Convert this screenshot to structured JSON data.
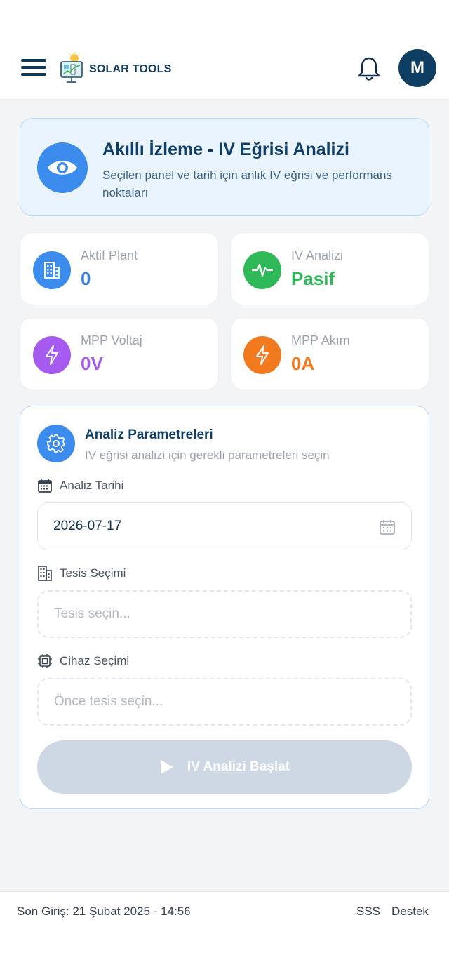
{
  "header": {
    "brand": "SOLAR TOOLS",
    "avatar_initial": "M"
  },
  "hero": {
    "title": "Akıllı İzleme - IV Eğrisi Analizi",
    "subtitle": "Seçilen panel ve tarih için anlık IV eğrisi ve performans noktaları"
  },
  "stats": [
    {
      "label": "Aktif Plant",
      "value": "0",
      "icon": "building-icon",
      "color": "#3b8ced"
    },
    {
      "label": "IV Analizi",
      "value": "Pasif",
      "icon": "activity-icon",
      "color": "#2fb858"
    },
    {
      "label": "MPP Voltaj",
      "value": "0V",
      "icon": "lightning-icon",
      "color": "#a55bf0"
    },
    {
      "label": "MPP Akım",
      "value": "0A",
      "icon": "lightning-icon",
      "color": "#f27a1e"
    }
  ],
  "panel": {
    "title": "Analiz Parametreleri",
    "subtitle": "IV eğrisi analizi için gerekli parametreleri seçin",
    "date_label": "Analiz Tarihi",
    "date_value": "2026-07-17",
    "facility_label": "Tesis Seçimi",
    "facility_placeholder": "Tesis seçin...",
    "device_label": "Cihaz Seçimi",
    "device_placeholder": "Önce tesis seçin...",
    "start_button": "IV Analizi Başlat"
  },
  "footer": {
    "last_login": "Son Giriş: 21 Şubat 2025 - 14:56",
    "faq": "SSS",
    "support": "Destek"
  },
  "colors": {
    "primary": "#0e3f62",
    "accent_blue": "#3b8ced",
    "green": "#2fb858",
    "purple": "#a55bf0",
    "orange": "#f27a1e",
    "disabled": "#cdd8e4"
  }
}
